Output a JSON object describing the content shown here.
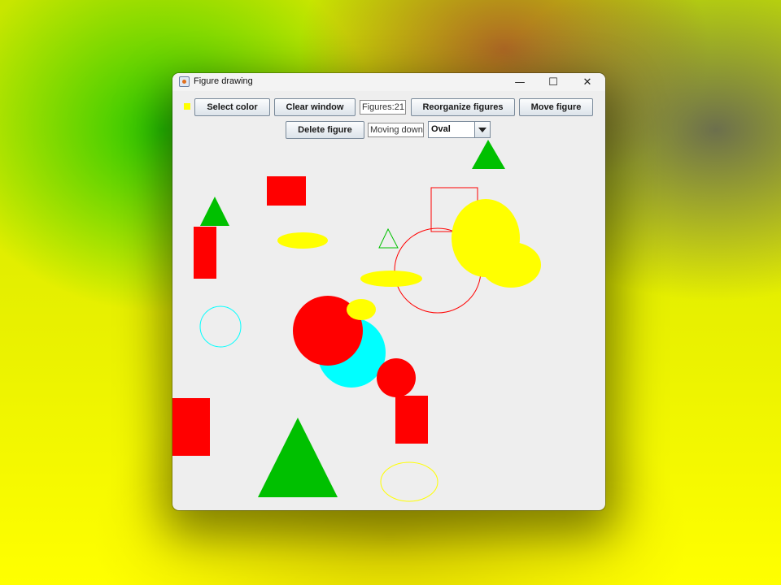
{
  "window": {
    "title": "Figure drawing",
    "controls": {
      "minimize": "—",
      "maximize": "☐",
      "close": "✕"
    }
  },
  "toolbar": {
    "current_color": "#ffff00",
    "select_color_label": "Select color",
    "clear_window_label": "Clear window",
    "figures_count_text": "Figures:21",
    "reorganize_label": "Reorganize figures",
    "move_figure_label": "Move figure",
    "delete_figure_label": "Delete figure",
    "direction_text": "Moving down",
    "shape_select": {
      "selected": "Oval"
    }
  },
  "colors": {
    "red": "#ff0000",
    "green": "#00c000",
    "yellow": "#ffff00",
    "cyan": "#00ffff"
  },
  "icons": {
    "app": "java-coffee-icon",
    "combo_arrow": "triangle-down-icon"
  }
}
